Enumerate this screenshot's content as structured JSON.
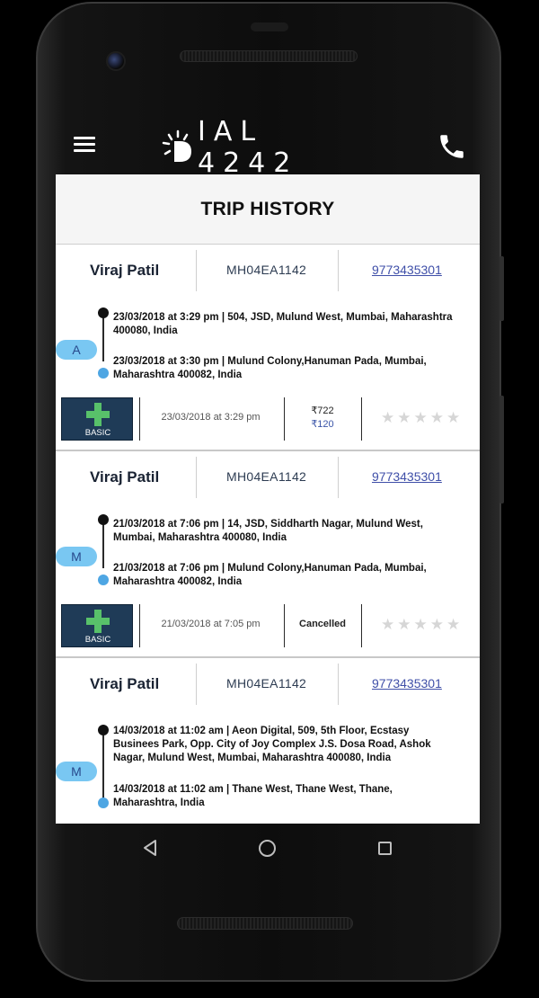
{
  "app": {
    "logo_text": "IAL 4242",
    "page_title": "TRIP HISTORY"
  },
  "trips": [
    {
      "driver": "Viraj Patil",
      "vehicle": "MH04EA1142",
      "phone": "9773435301",
      "badge": "A",
      "pickup": "23/03/2018 at 3:29 pm | 504, JSD, Mulund West, Mumbai, Maharashtra 400080, India",
      "drop": "23/03/2018 at 3:30 pm | Mulund Colony,Hanuman Pada, Mumbai, Maharashtra 400082, India",
      "vehicle_type": "BASIC",
      "booked_at": "23/03/2018 at 3:29 pm",
      "fare_total": "₹722",
      "fare_paid": "₹120",
      "status": "",
      "rating": 0
    },
    {
      "driver": "Viraj Patil",
      "vehicle": "MH04EA1142",
      "phone": "9773435301",
      "badge": "M",
      "pickup": "21/03/2018 at 7:06 pm | 14, JSD, Siddharth Nagar, Mulund West, Mumbai, Maharashtra 400080, India",
      "drop": "21/03/2018 at 7:06 pm | Mulund Colony,Hanuman Pada, Mumbai, Maharashtra 400082, India",
      "vehicle_type": "BASIC",
      "booked_at": "21/03/2018 at 7:05 pm",
      "fare_total": "",
      "fare_paid": "",
      "status": "Cancelled",
      "rating": 0
    },
    {
      "driver": "Viraj Patil",
      "vehicle": "MH04EA1142",
      "phone": "9773435301",
      "badge": "M",
      "pickup": "14/03/2018 at 11:02 am | Aeon Digital, 509, 5th Floor, Ecstasy Businees Park, Opp. City of Joy Complex J.S. Dosa Road, Ashok Nagar, Mulund West, Mumbai, Maharashtra 400080, India",
      "drop": "14/03/2018 at 11:02 am | Thane West, Thane West, Thane, Maharashtra, India"
    }
  ],
  "icons": {
    "menu": "menu-icon",
    "phone": "phone-icon",
    "star": "star-icon",
    "back": "back-triangle-icon",
    "home": "home-circle-icon",
    "recent": "recent-square-icon"
  },
  "colors": {
    "badge_bg": "#79c7f2",
    "route_end": "#4ea6e3",
    "link": "#3f4fa8",
    "vehicle_tile": "#1f3b57",
    "cross": "#58c16a"
  }
}
